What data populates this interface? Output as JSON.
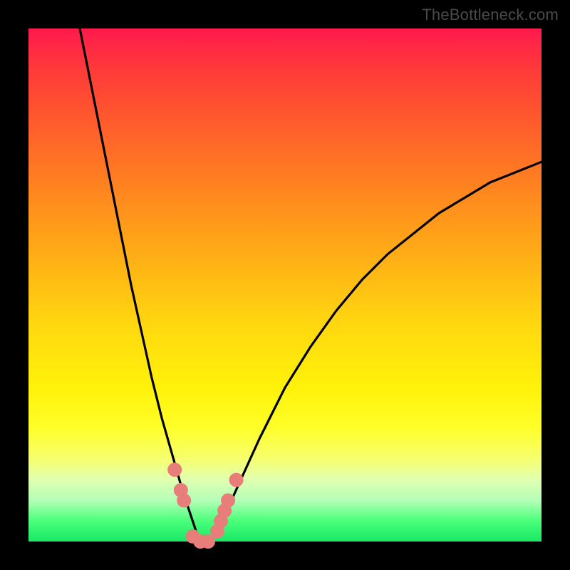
{
  "watermark": {
    "text": "TheBottleneck.com"
  },
  "chart_data": {
    "type": "line",
    "title": "",
    "xlabel": "",
    "ylabel": "",
    "xlim": [
      0,
      100
    ],
    "ylim": [
      0,
      100
    ],
    "series": [
      {
        "name": "bottleneck-curve",
        "x": [
          10,
          12,
          14,
          16,
          18,
          20,
          22,
          24,
          26,
          28,
          30,
          32,
          33,
          34,
          36,
          38,
          40,
          45,
          50,
          55,
          60,
          65,
          70,
          75,
          80,
          85,
          90,
          95,
          100
        ],
        "y": [
          100,
          90,
          80,
          70,
          60,
          50,
          41,
          32,
          24,
          17,
          10,
          4,
          1,
          0,
          1,
          4,
          9,
          20,
          30,
          38,
          45,
          51,
          56,
          60,
          64,
          67,
          70,
          72,
          74
        ]
      }
    ],
    "markers": {
      "name": "annotated-points",
      "color": "#e77e7a",
      "points": [
        {
          "x": 28.5,
          "y": 14
        },
        {
          "x": 29.7,
          "y": 10
        },
        {
          "x": 30.3,
          "y": 8
        },
        {
          "x": 32.0,
          "y": 1
        },
        {
          "x": 33.5,
          "y": 0
        },
        {
          "x": 35.0,
          "y": 0
        },
        {
          "x": 36.8,
          "y": 2
        },
        {
          "x": 37.5,
          "y": 4
        },
        {
          "x": 38.2,
          "y": 6
        },
        {
          "x": 38.9,
          "y": 8
        },
        {
          "x": 40.5,
          "y": 12
        }
      ]
    },
    "gradient_stops": [
      {
        "pos": 0,
        "color": "#19e865"
      },
      {
        "pos": 8,
        "color": "#b3ffb8"
      },
      {
        "pos": 20,
        "color": "#fff20a"
      },
      {
        "pos": 50,
        "color": "#ff9a1a"
      },
      {
        "pos": 100,
        "color": "#ff1a4d"
      }
    ]
  }
}
